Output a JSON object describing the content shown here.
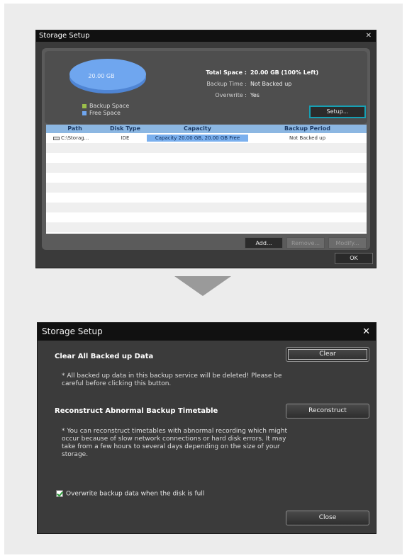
{
  "top_dialog": {
    "title": "Storage Setup",
    "close_glyph": "✕",
    "pie": {
      "label": "20.00 GB",
      "backup_color": "#9bbf4a",
      "free_color": "#6fa6ef"
    },
    "legend": {
      "backup": "Backup Space",
      "free": "Free Space"
    },
    "info": {
      "total_key": "Total Space :",
      "total_val": "20.00 GB (100% Left)",
      "backup_key": "Backup Time :",
      "backup_val": "Not Backed up",
      "overwrite_key": "Overwrite :",
      "overwrite_val": "Yes"
    },
    "setup_button": "Setup...",
    "table": {
      "headers": [
        "Path",
        "Disk Type",
        "Capacity",
        "Backup Period"
      ],
      "rows": [
        {
          "path": "C:\\Storag...",
          "disk_type": "IDE",
          "capacity": "Capacity 20.00 GB, 20.00 GB Free",
          "period": "Not Backed up"
        }
      ]
    },
    "buttons": {
      "add": "Add...",
      "remove": "Remove...",
      "modify": "Modify..."
    },
    "ok_button": "OK"
  },
  "bottom_dialog": {
    "title": "Storage Setup",
    "close_glyph": "✕",
    "clear_heading": "Clear All Backed up Data",
    "clear_text": "* All backed up data in this backup service will be deleted! Please be careful before clicking this button.",
    "clear_button": "Clear",
    "reconstruct_heading": "Reconstruct Abnormal Backup Timetable",
    "reconstruct_text": "* You can reconstruct timetables with abnormal recording which might occur because of slow network connections or hard disk errors. It may take from a few hours to several days depending on the size of your storage.",
    "reconstruct_button": "Reconstruct",
    "overwrite_checkbox": "Overwrite backup data when the disk is full",
    "overwrite_checked": true,
    "close_button": "Close"
  }
}
